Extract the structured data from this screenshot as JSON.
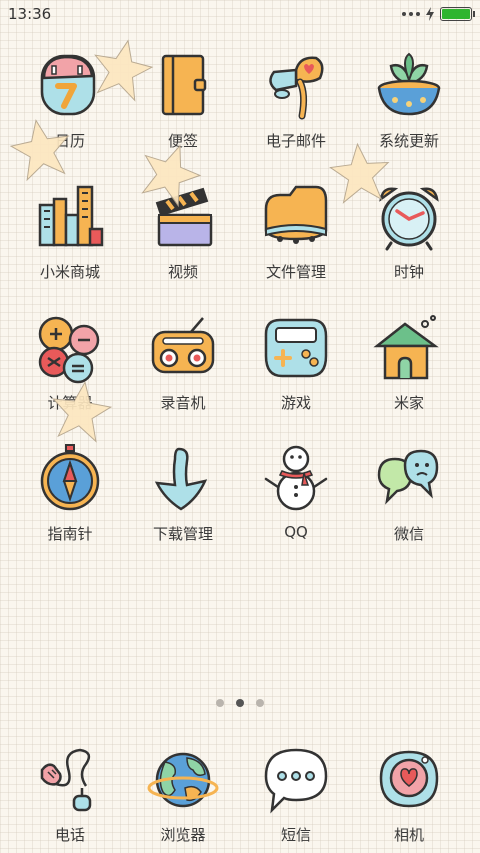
{
  "status_bar": {
    "time": "13:36",
    "battery_level": 1.0,
    "battery_color": "#2fb52f"
  },
  "grid_apps": [
    {
      "label": "日历",
      "icon": "calendar-icon"
    },
    {
      "label": "便签",
      "icon": "notes-icon"
    },
    {
      "label": "电子邮件",
      "icon": "mailbox-icon"
    },
    {
      "label": "系统更新",
      "icon": "update-bowl-icon"
    },
    {
      "label": "小米商城",
      "icon": "store-city-icon"
    },
    {
      "label": "视频",
      "icon": "clapperboard-icon"
    },
    {
      "label": "文件管理",
      "icon": "folder-icon"
    },
    {
      "label": "时钟",
      "icon": "alarm-clock-icon"
    },
    {
      "label": "计算器",
      "icon": "calculator-icon"
    },
    {
      "label": "录音机",
      "icon": "radio-recorder-icon"
    },
    {
      "label": "游戏",
      "icon": "gamepad-icon"
    },
    {
      "label": "米家",
      "icon": "house-icon"
    },
    {
      "label": "指南针",
      "icon": "compass-icon"
    },
    {
      "label": "下载管理",
      "icon": "download-arrow-icon"
    },
    {
      "label": "QQ",
      "icon": "snowman-icon"
    },
    {
      "label": "微信",
      "icon": "chat-bubbles-icon"
    }
  ],
  "page_indicator": {
    "count": 3,
    "active_index": 1
  },
  "dock_apps": [
    {
      "label": "电话",
      "icon": "phone-icon"
    },
    {
      "label": "浏览器",
      "icon": "globe-icon"
    },
    {
      "label": "短信",
      "icon": "speech-bubble-icon"
    },
    {
      "label": "相机",
      "icon": "camera-heart-icon"
    }
  ]
}
